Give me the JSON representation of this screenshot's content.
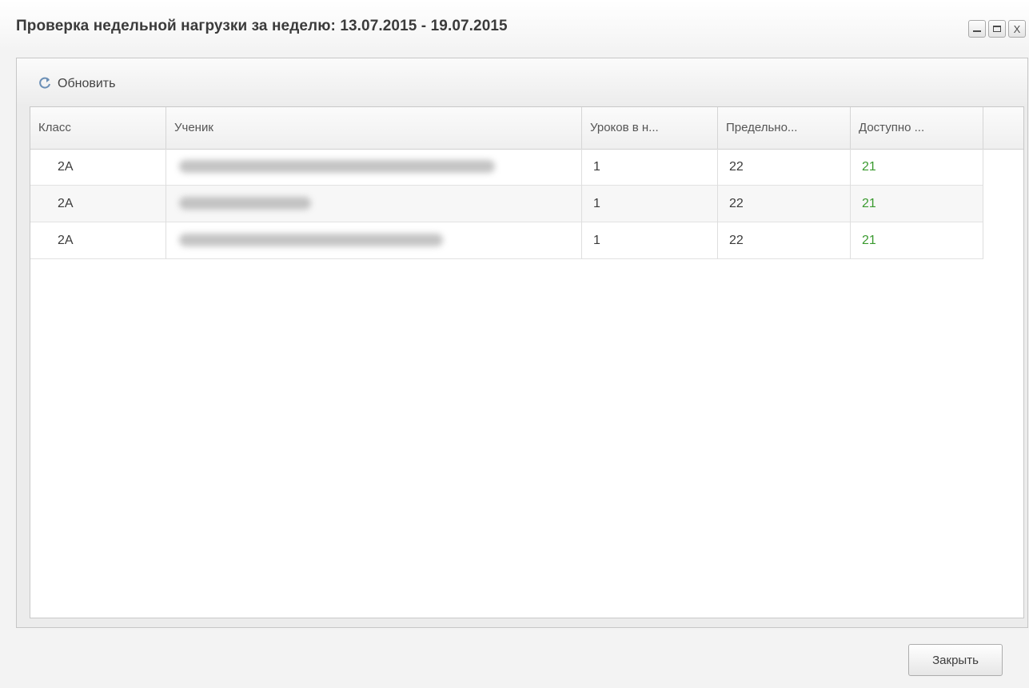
{
  "window": {
    "title": "Проверка недельной нагрузки за неделю: 13.07.2015 - 19.07.2015",
    "controls": {
      "minimize_icon": "minimize-icon",
      "maximize_icon": "maximize-icon",
      "close_glyph": "X"
    }
  },
  "toolbar": {
    "refresh_icon": "refresh-icon",
    "refresh_label": "Обновить"
  },
  "table": {
    "columns": [
      "Класс",
      "Ученик",
      "Уроков в н...",
      "Предельно...",
      "Доступно ..."
    ],
    "rows": [
      {
        "class": "2A",
        "student": "",
        "lessons": "1",
        "limit": "22",
        "available": "21"
      },
      {
        "class": "2A",
        "student": "",
        "lessons": "1",
        "limit": "22",
        "available": "21"
      },
      {
        "class": "2A",
        "student": "",
        "lessons": "1",
        "limit": "22",
        "available": "21"
      }
    ]
  },
  "footer": {
    "close_label": "Закрыть"
  },
  "colors": {
    "available_value": "#3a9a2f"
  }
}
